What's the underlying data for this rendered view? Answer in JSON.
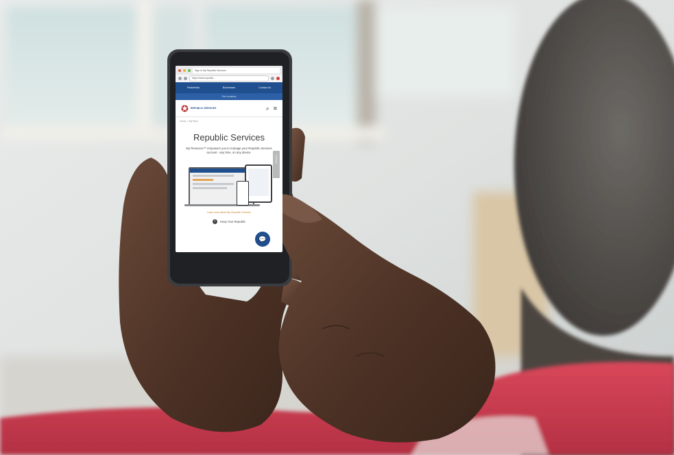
{
  "browser": {
    "tab_title": "Sign In My Republic Services",
    "address": "https://www.republic..."
  },
  "site_nav": {
    "items": [
      "Residential",
      "Businesses",
      "Contact Us"
    ],
    "sub_label": "Find Locations"
  },
  "header": {
    "logo_text": "REPUBLIC SERVICES",
    "search_icon": "search-icon",
    "menu_icon": "hamburger-menu-icon"
  },
  "breadcrumb": "Home > My Resi",
  "main": {
    "title": "Republic Services",
    "subtitle": "My Resource™ empowers you to manage your Republic Services account - any time, on any device.",
    "side_tab_label": "Feedback",
    "cta": "Learn more about My Republic Services",
    "bottom_link": "Keep Your Republic",
    "chat_icon": "chat-bubble-icon"
  },
  "colors": {
    "brand_blue": "#1f4f8f",
    "brand_red": "#b8262b",
    "accent_orange": "#c77d1b"
  }
}
